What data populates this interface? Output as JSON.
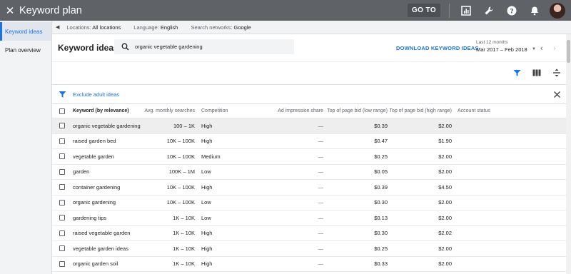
{
  "topbar": {
    "title": "Keyword plan",
    "goto_label": "GO TO"
  },
  "sidebar": {
    "items": [
      {
        "label": "Keyword ideas"
      },
      {
        "label": "Plan overview"
      }
    ]
  },
  "filters": {
    "locations_label": "Locations:",
    "locations_value": "All locations",
    "language_label": "Language:",
    "language_value": "English",
    "networks_label": "Search networks:",
    "networks_value": "Google"
  },
  "keyword_ideas": {
    "title": "Keyword ideas",
    "search_value": "organic vegetable gardening",
    "download_label": "DOWNLOAD KEYWORD IDEAS",
    "date_label": "Last 12 months",
    "date_value": "Mar 2017 – Feb 2018"
  },
  "exclude": {
    "label": "Exclude adult ideas"
  },
  "table": {
    "headers": {
      "keyword": "Keyword (by relevance)",
      "avg": "Avg. monthly searches",
      "competition": "Competition",
      "impression": "Ad impression share",
      "bid_low": "Top of page bid (low range)",
      "bid_high": "Top of page bid (high range)",
      "account": "Account status"
    },
    "rows": [
      {
        "keyword": "organic vegetable gardening",
        "avg": "100 – 1K",
        "competition": "High",
        "impression": "—",
        "bid_low": "$0.39",
        "bid_high": "$2.00"
      },
      {
        "keyword": "raised garden bed",
        "avg": "10K – 100K",
        "competition": "High",
        "impression": "—",
        "bid_low": "$0.47",
        "bid_high": "$1.90"
      },
      {
        "keyword": "vegetable garden",
        "avg": "10K – 100K",
        "competition": "Medium",
        "impression": "—",
        "bid_low": "$0.25",
        "bid_high": "$2.00"
      },
      {
        "keyword": "garden",
        "avg": "100K – 1M",
        "competition": "Low",
        "impression": "—",
        "bid_low": "$0.05",
        "bid_high": "$2.00"
      },
      {
        "keyword": "container gardening",
        "avg": "10K – 100K",
        "competition": "High",
        "impression": "—",
        "bid_low": "$0.39",
        "bid_high": "$4.50"
      },
      {
        "keyword": "organic gardening",
        "avg": "10K – 100K",
        "competition": "Low",
        "impression": "—",
        "bid_low": "$0.30",
        "bid_high": "$2.00"
      },
      {
        "keyword": "gardening tips",
        "avg": "1K – 10K",
        "competition": "Low",
        "impression": "—",
        "bid_low": "$0.13",
        "bid_high": "$2.00"
      },
      {
        "keyword": "raised vegetable garden",
        "avg": "1K – 10K",
        "competition": "High",
        "impression": "—",
        "bid_low": "$0.30",
        "bid_high": "$2.02"
      },
      {
        "keyword": "vegetable garden ideas",
        "avg": "1K – 10K",
        "competition": "High",
        "impression": "—",
        "bid_low": "$0.25",
        "bid_high": "$2.00"
      },
      {
        "keyword": "organic garden soil",
        "avg": "1K – 10K",
        "competition": "High",
        "impression": "—",
        "bid_low": "$0.33",
        "bid_high": "$2.00"
      }
    ]
  },
  "colors": {
    "topbar": "#5f6368",
    "accent": "#1a73e8"
  },
  "icons": [
    "close-icon",
    "reports-icon",
    "wrench-icon",
    "help-icon",
    "bell-icon",
    "search-icon",
    "filter-icon",
    "columns-icon",
    "segment-icon",
    "chevron-left-icon",
    "chevron-right-icon",
    "dropdown-icon"
  ]
}
